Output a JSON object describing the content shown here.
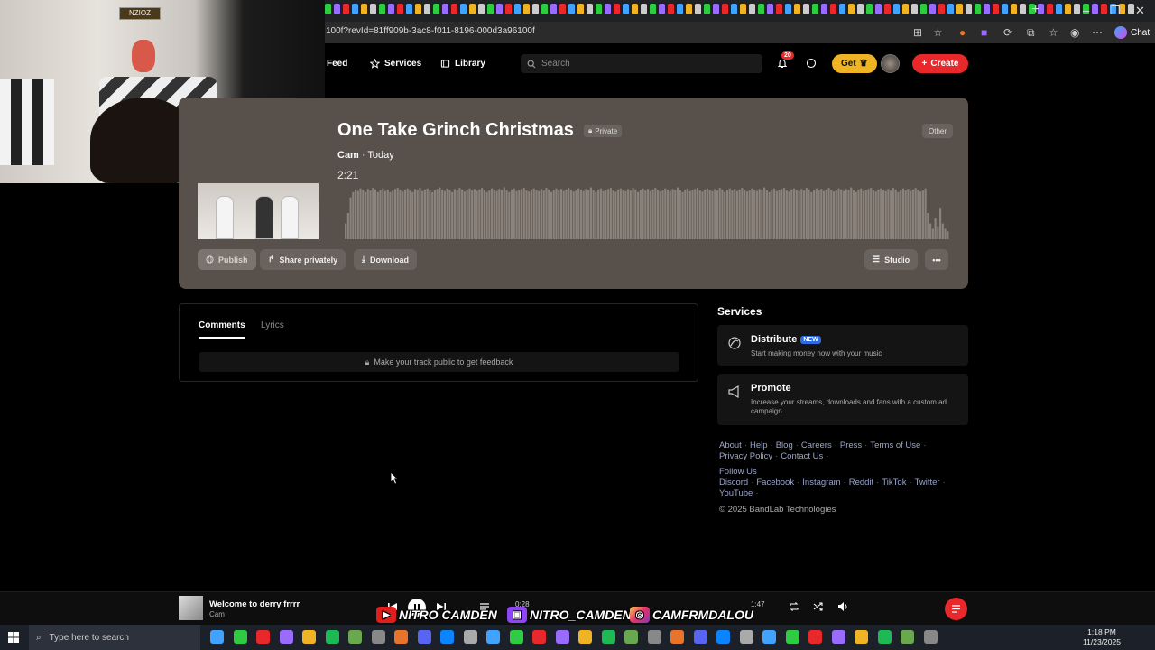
{
  "browser": {
    "url": "100f?revId=81ff909b-3ac8-f011-8196-000d3a96100f",
    "chat_label": "Chat"
  },
  "webcam": {
    "sign_text": "NZIOZ"
  },
  "nav": {
    "feed": "Feed",
    "services": "Services",
    "library": "Library",
    "search_placeholder": "Search",
    "notifications_count": "20",
    "get_label": "Get",
    "create_label": "Create"
  },
  "track": {
    "title": "One Take Grinch Christmas",
    "privacy": "Private",
    "genre": "Other",
    "artist": "Cam",
    "separator": " · ",
    "date": "Today",
    "duration": "2:21",
    "actions": {
      "publish": "Publish",
      "share": "Share privately",
      "download": "Download",
      "studio": "Studio"
    },
    "waveform_levels": [
      0.3,
      0.5,
      0.8,
      0.9,
      0.95,
      0.92,
      0.97,
      0.94,
      0.9,
      0.96,
      0.93,
      0.98,
      0.95,
      0.9,
      0.94,
      0.97,
      0.92,
      0.95,
      0.9,
      0.93,
      0.96,
      0.98,
      0.94,
      0.91,
      0.95,
      0.97,
      0.93,
      0.9,
      0.96,
      0.94,
      0.98,
      0.92,
      0.95,
      0.97,
      0.93,
      0.9,
      0.94,
      0.96,
      0.99,
      0.95,
      0.92,
      0.97,
      0.94,
      0.9,
      0.96,
      0.93,
      0.98,
      0.95,
      0.91,
      0.94,
      0.97,
      0.93,
      0.96,
      0.92,
      0.95,
      0.98,
      0.94,
      0.9,
      0.93,
      0.97,
      0.95,
      0.92,
      0.96,
      0.94,
      0.99,
      0.93,
      0.9,
      0.95,
      0.97,
      0.92,
      0.94,
      0.96,
      0.98,
      0.93,
      0.91,
      0.95,
      0.97,
      0.94,
      0.92,
      0.96,
      0.93,
      0.98,
      0.95,
      0.9,
      0.94,
      0.97,
      0.93,
      0.96,
      0.92,
      0.95,
      0.98,
      0.94,
      0.91,
      0.93,
      0.97,
      0.95,
      0.92,
      0.96,
      0.94,
      0.99,
      0.93,
      0.9,
      0.95,
      0.97,
      0.92,
      0.94,
      0.96,
      0.98,
      0.93,
      0.91,
      0.95,
      0.97,
      0.94,
      0.92,
      0.96,
      0.93,
      0.98,
      0.95,
      0.9,
      0.94,
      0.97,
      0.93,
      0.96,
      0.92,
      0.95,
      0.98,
      0.94,
      0.91,
      0.93,
      0.97,
      0.95,
      0.92,
      0.96,
      0.94,
      0.99,
      0.93,
      0.9,
      0.95,
      0.97,
      0.92,
      0.94,
      0.96,
      0.98,
      0.93,
      0.91,
      0.95,
      0.97,
      0.94,
      0.92,
      0.96,
      0.93,
      0.98,
      0.95,
      0.9,
      0.94,
      0.97,
      0.93,
      0.96,
      0.92,
      0.95,
      0.98,
      0.94,
      0.91,
      0.93,
      0.97,
      0.95,
      0.92,
      0.96,
      0.94,
      0.99,
      0.93,
      0.9,
      0.95,
      0.97,
      0.92,
      0.94,
      0.96,
      0.98,
      0.93,
      0.91,
      0.95,
      0.97,
      0.94,
      0.92,
      0.96,
      0.93,
      0.98,
      0.95,
      0.9,
      0.94,
      0.97,
      0.93,
      0.96,
      0.92,
      0.95,
      0.98,
      0.94,
      0.91,
      0.93,
      0.97,
      0.95,
      0.92,
      0.96,
      0.94,
      0.99,
      0.93,
      0.9,
      0.95,
      0.97,
      0.92,
      0.94,
      0.96,
      0.98,
      0.93,
      0.91,
      0.95,
      0.97,
      0.94,
      0.92,
      0.96,
      0.93,
      0.98,
      0.95,
      0.9,
      0.94,
      0.97,
      0.93,
      0.96,
      0.92,
      0.95,
      0.98,
      0.94,
      0.91,
      0.93,
      0.97,
      0.5,
      0.3,
      0.2,
      0.4,
      0.25,
      0.6,
      0.3,
      0.2,
      0.15
    ]
  },
  "comments": {
    "tab_comments": "Comments",
    "tab_lyrics": "Lyrics",
    "feedback_msg": "Make your track public to get feedback"
  },
  "services": {
    "title": "Services",
    "distribute": {
      "name": "Distribute",
      "tag": "NEW",
      "desc": "Start making money now with your music"
    },
    "promote": {
      "name": "Promote",
      "desc": "Increase your streams, downloads and fans with a custom ad campaign"
    }
  },
  "footer": {
    "links1": [
      "About",
      "Help",
      "Blog",
      "Careers",
      "Press",
      "Terms of Use"
    ],
    "links2": [
      "Privacy Policy",
      "Contact Us"
    ],
    "follow": "Follow Us",
    "social1": [
      "Discord",
      "Facebook",
      "Instagram",
      "Reddit",
      "TikTok",
      "Twitter"
    ],
    "social2": [
      "YouTube"
    ],
    "copyright": "© 2025 BandLab Technologies"
  },
  "player": {
    "title": "Welcome to derry frrrr",
    "artist": "Cam",
    "elapsed": "0:28",
    "total": "1:47",
    "overlay_youtube": "NITRO CAMDEN",
    "overlay_twitch": "NITRO_CAMDEN",
    "overlay_instagram": "CAMFRMDALOU"
  },
  "taskbar": {
    "search_placeholder": "Type here to search",
    "time": "1:18 PM",
    "date": "11/23/2025"
  },
  "colors": {
    "accent_red": "#e8282b",
    "get_yellow": "#f0b323",
    "card_bg": "#58504a",
    "new_tag": "#2f6ae0"
  }
}
